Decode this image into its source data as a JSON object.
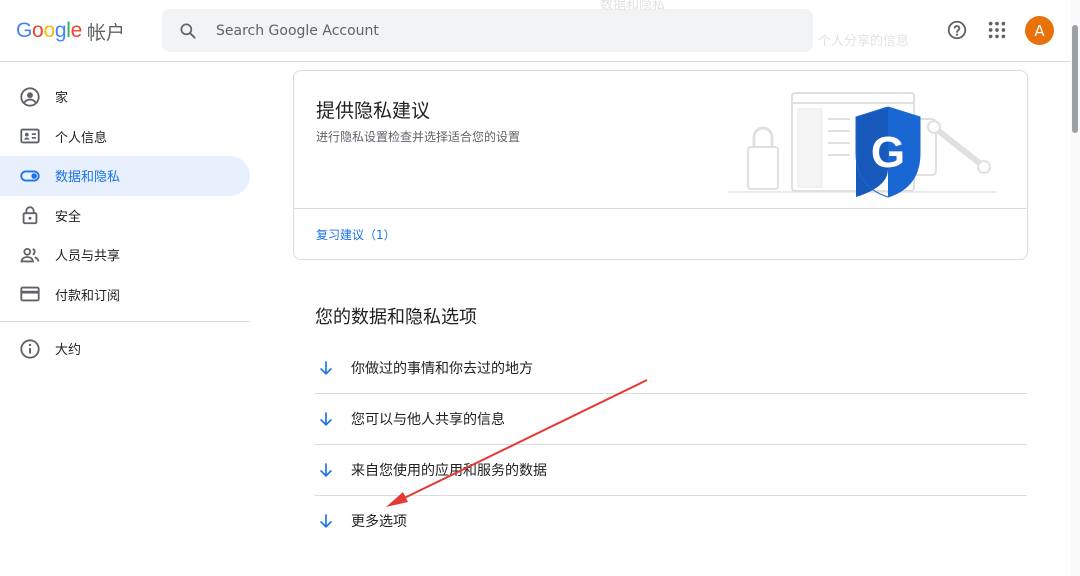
{
  "header": {
    "logo_letters": [
      "G",
      "o",
      "o",
      "g",
      "l",
      "e"
    ],
    "product": "帐户",
    "search_placeholder": "Search Google Account",
    "avatar_letter": "A",
    "ghost_texts": [
      "数据和隐私",
      "个人分享的信息"
    ]
  },
  "sidebar": {
    "items": [
      {
        "label": "家",
        "icon": "account-circle-icon"
      },
      {
        "label": "个人信息",
        "icon": "id-card-icon"
      },
      {
        "label": "数据和隐私",
        "icon": "toggle-icon",
        "active": true
      },
      {
        "label": "安全",
        "icon": "lock-icon"
      },
      {
        "label": "人员与共享",
        "icon": "people-icon"
      },
      {
        "label": "付款和订阅",
        "icon": "credit-card-icon"
      }
    ],
    "about": {
      "label": "大约",
      "icon": "info-icon"
    }
  },
  "privacy_card": {
    "title": "提供隐私建议",
    "subtitle": "进行隐私设置检查并选择适合您的设置",
    "review_link": "复习建议（1）"
  },
  "options": {
    "title": "您的数据和隐私选项",
    "items": [
      {
        "label": "你做过的事情和你去过的地方"
      },
      {
        "label": "您可以与他人共享的信息"
      },
      {
        "label": "来自您使用的应用和服务的数据"
      },
      {
        "label": "更多选项"
      }
    ]
  },
  "colors": {
    "accent": "#1a73e8",
    "active_bg": "#e8f0fe",
    "avatar": "#e8710a",
    "annotation": "#e53935"
  }
}
